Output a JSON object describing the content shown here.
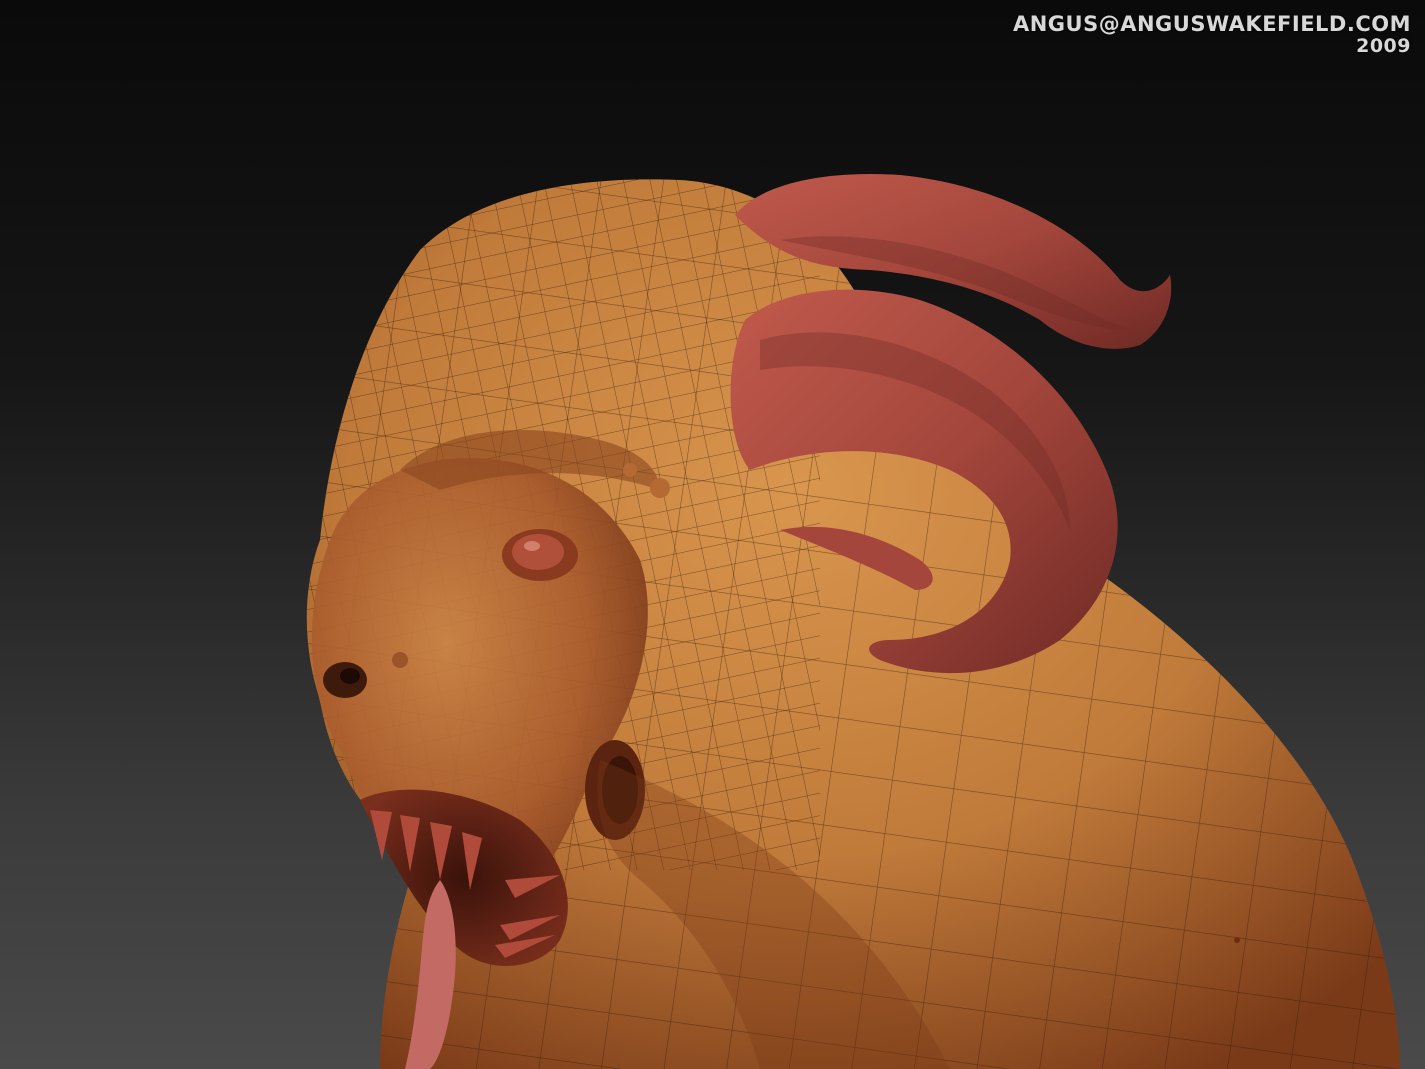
{
  "credit": {
    "email": "ANGUS@ANGUSWAKEFIELD.COM",
    "year": "2009"
  },
  "render": {
    "subject": "horned creature sculpt with wireframe overlay",
    "colors": {
      "skin": "#c07a3a",
      "skin_shadow": "#7a3a18",
      "horn": "#a4463c",
      "horn_dark": "#6e2a24",
      "background_top": "#0a0a0a",
      "background_bottom": "#4a4a4a"
    }
  }
}
